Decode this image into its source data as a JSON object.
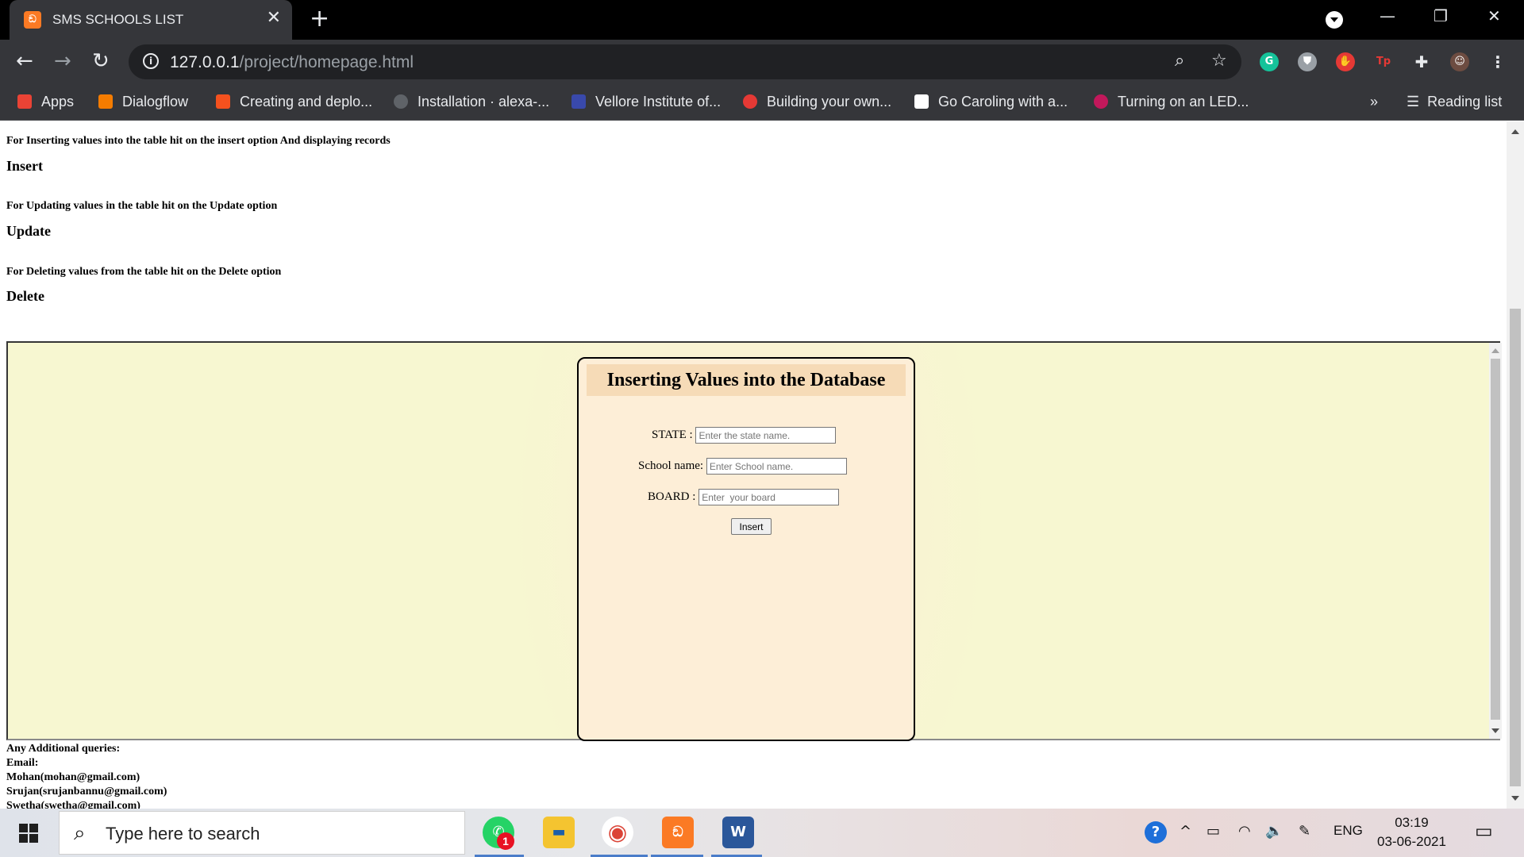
{
  "browser": {
    "tab_title": "SMS SCHOOLS LIST",
    "tab_favicon": "xampp",
    "url_host": "127.0.0.1",
    "url_path": "/project/homepage.html",
    "bookmarks": [
      {
        "label": "Apps",
        "icon": "apps-grid-icon",
        "color": "#ea4335"
      },
      {
        "label": "Dialogflow",
        "icon": "dialogflow-icon",
        "color": "#f57c00"
      },
      {
        "label": "Creating and deplo...",
        "icon": "chevron-icon",
        "color": "#f4511e"
      },
      {
        "label": "Installation · alexa-...",
        "icon": "github-icon",
        "color": "#5f6368"
      },
      {
        "label": "Vellore Institute of...",
        "icon": "vit-icon",
        "color": "#3949ab"
      },
      {
        "label": "Building your own...",
        "icon": "upgrad-icon",
        "color": "#e53935"
      },
      {
        "label": "Go Caroling with a...",
        "icon": "medium-icon",
        "color": "#ffffff"
      },
      {
        "label": "Turning on an LED...",
        "icon": "raspberry-icon",
        "color": "#c2185b"
      }
    ],
    "reading_list": "Reading list",
    "more_bookmarks": "»"
  },
  "page": {
    "insert_hint": "For Inserting values into the table hit on the insert option And displaying records",
    "insert_link": "Insert",
    "update_hint": "For Updating values in the table hit on the Update option",
    "update_link": "Update",
    "delete_hint": "For Deleting values from the table hit on the Delete option",
    "delete_link": "Delete",
    "form": {
      "title": "Inserting Values into the Database",
      "state_label": "STATE :",
      "state_placeholder": "Enter the state name.",
      "school_label": "School name:",
      "school_placeholder": "Enter School name.",
      "board_label": "BOARD :",
      "board_placeholder": "Enter  your board",
      "submit_label": "Insert"
    },
    "footer": {
      "queries": "Any Additional queries:",
      "email": "Email:",
      "contacts": [
        "Mohan(mohan@gmail.com)",
        "Srujan(srujanbannu@gmail.com)",
        "Swetha(swetha@gmail.com)"
      ]
    }
  },
  "taskbar": {
    "search_placeholder": "Type here to search",
    "whatsapp_badge": "1",
    "language": "ENG",
    "time": "03:19",
    "date": "03-06-2021"
  }
}
